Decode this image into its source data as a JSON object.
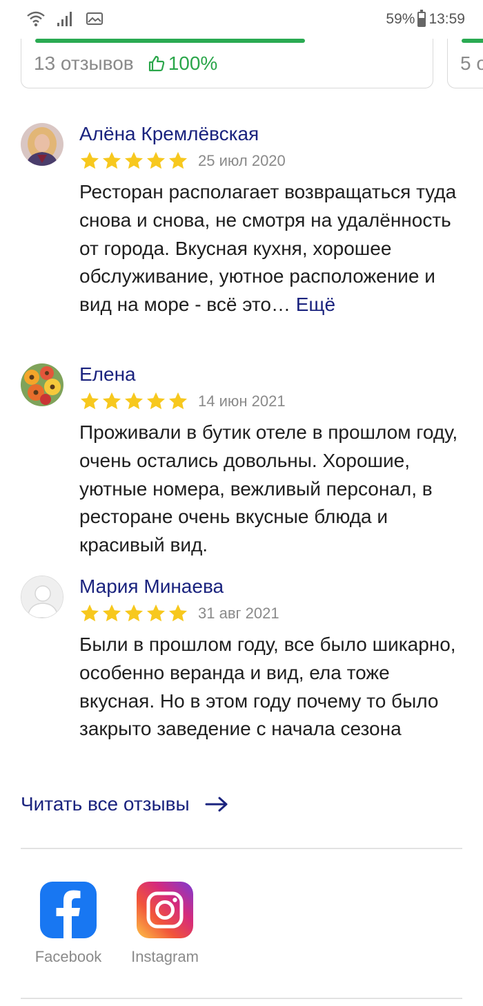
{
  "status_bar": {
    "battery": "59%",
    "battery_level": 0.59,
    "time": "13:59",
    "icons": [
      "wifi-icon",
      "signal-icon",
      "image-icon",
      "battery-icon"
    ]
  },
  "summary": {
    "reviews_count": "13 отзывов",
    "likes_percent": "100%",
    "next_card_count": "5 о"
  },
  "reviews": [
    {
      "author": "Алёна Кремлёвская",
      "rating": 5,
      "date": "25 июл 2020",
      "text": "Ресторан располагает возвращаться туда снова и снова, не смотря на удалённость от города. Вкусная кухня, хорошее обслуживание, уютное расположение и вид на море - всё это…",
      "more_label": "Ещё"
    },
    {
      "author": "Елена",
      "rating": 5,
      "date": "14 июн 2021",
      "text": "Проживали в бутик отеле в прошлом году, очень остались довольны. Хорошие, уютные номера, вежливый персонал, в ресторане очень вкусные блюда и красивый вид."
    },
    {
      "author": "Мария Минаева",
      "rating": 5,
      "date": "31 авг 2021",
      "text": "Были в прошлом году, все было шикарно, особенно веранда и вид, ела тоже вкусная. Но в этом году почему то было закрыто заведение с начала сезона"
    }
  ],
  "read_all_label": "Читать все отзывы",
  "social": [
    {
      "label": "Facebook",
      "icon": "facebook-icon"
    },
    {
      "label": "Instagram",
      "icon": "instagram-icon"
    }
  ],
  "colors": {
    "accent_green": "#2aaa52",
    "link_blue": "#1a237e",
    "star_yellow": "#f7c81e",
    "muted_gray": "#8a8a8a",
    "facebook_blue": "#1877f2"
  }
}
